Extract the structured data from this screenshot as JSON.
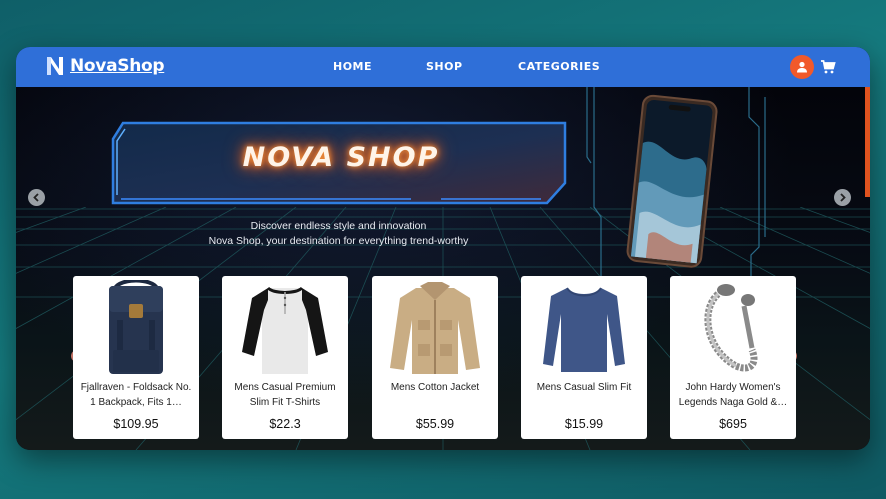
{
  "brand": {
    "name": "NovaShop",
    "logo_icon": "nova-n-logo"
  },
  "nav": {
    "links": [
      "HOME",
      "SHOP",
      "CATEGORIES"
    ],
    "user_icon": "user-icon",
    "cart_icon": "cart-icon",
    "accent": "#2f6fd8",
    "user_color": "#f1592a"
  },
  "hero": {
    "title": "NOVA SHOP",
    "tagline_line1": "Discover endless style and innovation",
    "tagline_line2": "Nova Shop, your destination for everything trend-worthy"
  },
  "products": [
    {
      "name": "Fjallraven - Foldsack No. 1 Backpack, Fits 1…",
      "price": "$109.95",
      "image": "backpack"
    },
    {
      "name": "Mens Casual Premium Slim Fit T-Shirts",
      "price": "$22.3",
      "image": "raglan-shirt"
    },
    {
      "name": "Mens Cotton Jacket",
      "price": "$55.99",
      "image": "cotton-jacket"
    },
    {
      "name": "Mens Casual Slim Fit",
      "price": "$15.99",
      "image": "long-sleeve-tee"
    },
    {
      "name": "John Hardy Women's Legends Naga Gold &…",
      "price": "$695",
      "image": "bracelet"
    }
  ]
}
